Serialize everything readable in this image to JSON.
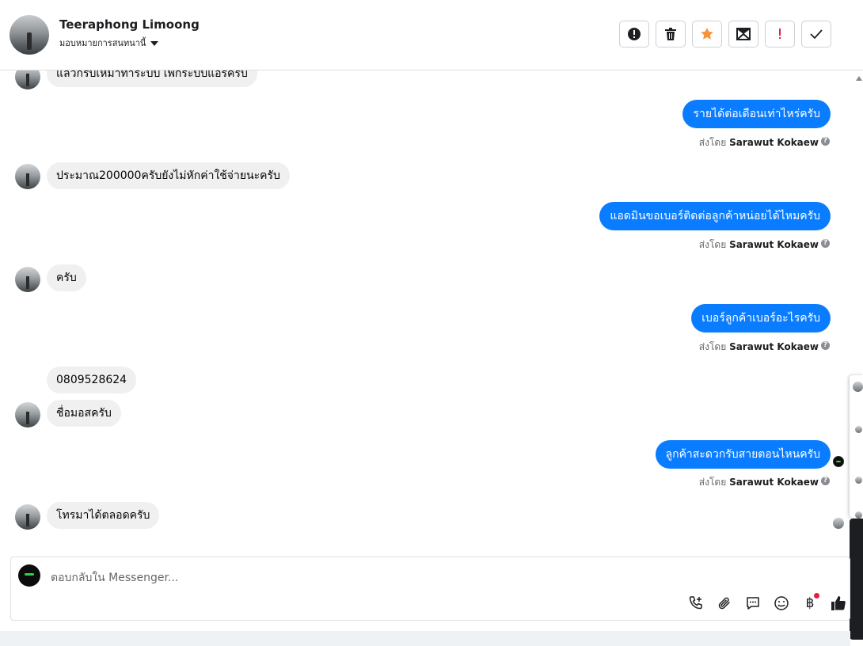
{
  "header": {
    "contact_name": "Teeraphong Limoong",
    "assign_label": "มอบหมายการสนทนานี้",
    "actions": [
      {
        "name": "alert-button",
        "icon": "exclamation-circle-icon"
      },
      {
        "name": "delete-button",
        "icon": "trash-icon"
      },
      {
        "name": "star-button",
        "icon": "star-icon",
        "color": "#f7923a"
      },
      {
        "name": "mark-unread-button",
        "icon": "envelope-icon"
      },
      {
        "name": "important-button",
        "icon": "exclamation-icon",
        "color": "#e41e3f"
      },
      {
        "name": "done-button",
        "icon": "check-icon"
      }
    ]
  },
  "thread": {
    "messages": [
      {
        "from": "customer",
        "text": "แล้วกรับเหมาทำระบบ เพิกระบบแอร์ครับ"
      },
      {
        "from": "page",
        "text": "รายได้ต่อเดือนเท่าไหร่ครับ",
        "sent_by_prefix": "ส่งโดย",
        "sent_by_name": "Sarawut Kokaew"
      },
      {
        "from": "customer",
        "text": "ประมาณ200000ครับยังไม่หักค่าใช้จ่ายนะครับ"
      },
      {
        "from": "page",
        "text": "แอดมินขอเบอร์ติดต่อลูกค้าหน่อยได้ไหมครับ",
        "sent_by_prefix": "ส่งโดย",
        "sent_by_name": "Sarawut Kokaew"
      },
      {
        "from": "customer",
        "text": "ครับ"
      },
      {
        "from": "page",
        "text": "เบอร์ลูกค้าเบอร์อะไรครับ",
        "sent_by_prefix": "ส่งโดย",
        "sent_by_name": "Sarawut Kokaew"
      },
      {
        "from": "customer",
        "text": "0809528624"
      },
      {
        "from": "customer",
        "text": "ชื่อมอสครับ"
      },
      {
        "from": "page",
        "text": "ลูกค้าสะดวกรับสายตอนไหนครับ",
        "sent_by_prefix": "ส่งโดย",
        "sent_by_name": "Sarawut Kokaew"
      },
      {
        "from": "customer",
        "text": "โทรมาได้ตลอดครับ"
      }
    ]
  },
  "composer": {
    "placeholder": "ตอบกลับใน Messenger...",
    "tools": [
      "phone-add-icon",
      "paperclip-icon",
      "saved-reply-icon",
      "emoji-icon",
      "baht-payment-icon",
      "thumbs-up-icon"
    ],
    "baht_symbol": "฿"
  },
  "colors": {
    "outgoing_bubble": "#0a7cff",
    "incoming_bubble": "#f0f0f0",
    "star": "#f7923a",
    "important": "#e41e3f"
  }
}
